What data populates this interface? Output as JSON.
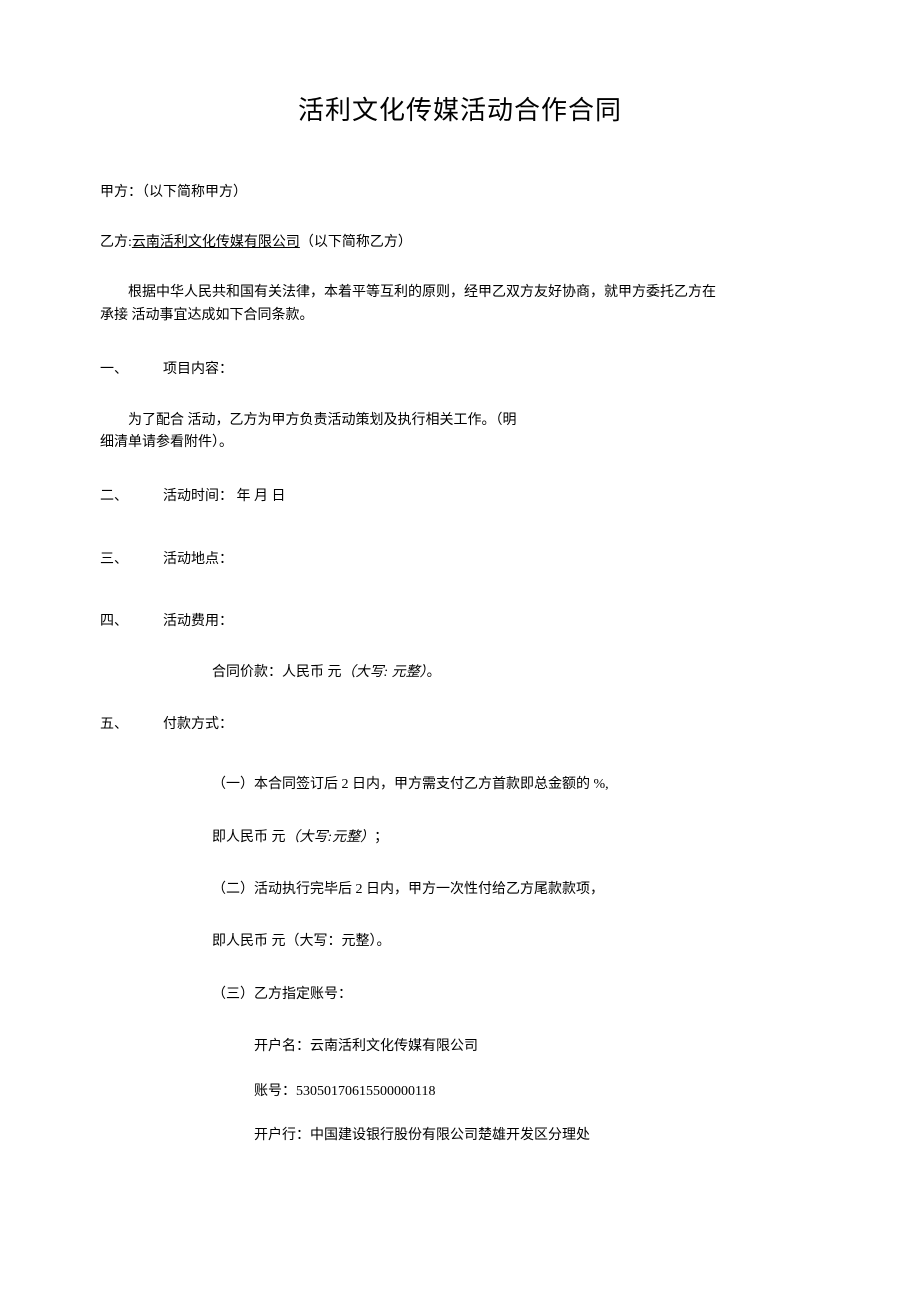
{
  "title": "活利文化传媒活动合作合同",
  "partyA_line": "甲方：（以下简称甲方）",
  "partyB_prefix": "乙方:",
  "partyB_name": "云南活利文化传媒有限公司",
  "partyB_suffix": "（以下简称乙方）",
  "preamble_1": "根据中华人民共和国有关法律，本着平等互利的原则，经甲乙双方友好协商，就甲方委托乙方在",
  "preamble_2": "承接 活动事宜达成如下合同条款。",
  "s1_num": "一、",
  "s1_label": "项目内容：",
  "s1_body_1": "为了配合 活动，乙方为甲方负责活动策划及执行相关工作。（明",
  "s1_body_2": "细清单请参看附件）。",
  "s2_num": "二、",
  "s2_label": "活动时间：  年 月 日",
  "s3_num": "三、",
  "s3_label": "活动地点：",
  "s4_num": "四、",
  "s4_label": "活动费用：",
  "s4_price_prefix": "合同价款：人民币  元",
  "s4_price_italic": "（大写:  元整）",
  "s4_price_suffix": "。",
  "s5_num": "五、",
  "s5_label": "付款方式：",
  "s5_i1": "（一）本合同签订后 2 日内，甲方需支付乙方首款即总金额的  %,",
  "s5_i2_prefix": "即人民币  元",
  "s5_i2_italic": "（大写:元整）",
  "s5_i2_suffix": "；",
  "s5_i3": "（二）活动执行完毕后 2 日内，甲方一次性付给乙方尾款款项，",
  "s5_i4": "即人民币  元（大写：元整）。",
  "s5_i5": "（三）乙方指定账号：",
  "acct_name": "开户名：云南活利文化传媒有限公司",
  "acct_no": "账号：53050170615500000118",
  "acct_bank": "开户行：中国建设银行股份有限公司楚雄开发区分理处"
}
